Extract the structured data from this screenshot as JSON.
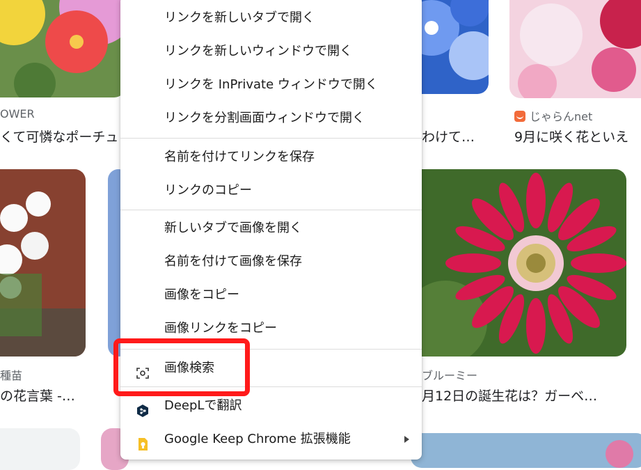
{
  "background_cards": {
    "card1_source": "OWER",
    "card1_title": "くて可憐なポーチュ",
    "card3_title": "わけて…",
    "card4_source": "じゃらんnet",
    "card4_title": "9月に咲く花といえ",
    "card5_source": "種苗",
    "card5_title": "の花言葉 -…",
    "card6_source": "ブルーミー",
    "card6_title": "月12日の誕生花は？ガーベ…"
  },
  "context_menu": {
    "items": [
      {
        "label": "リンクを新しいタブで開く"
      },
      {
        "label": "リンクを新しいウィンドウで開く"
      },
      {
        "label": "リンクを InPrivate ウィンドウで開く"
      },
      {
        "label": "リンクを分割画面ウィンドウで開く"
      },
      {
        "label": "名前を付けてリンクを保存"
      },
      {
        "label": "リンクのコピー"
      },
      {
        "label": "新しいタブで画像を開く"
      },
      {
        "label": "名前を付けて画像を保存"
      },
      {
        "label": "画像をコピー"
      },
      {
        "label": "画像リンクをコピー"
      },
      {
        "label": "画像検索",
        "icon": "visual-search-icon"
      },
      {
        "label": "DeepLで翻訳",
        "icon": "deepl-icon"
      },
      {
        "label": "Google Keep Chrome 拡張機能",
        "icon": "google-keep-icon",
        "has_submenu": true
      }
    ]
  },
  "colors": {
    "highlight_box": "#ff1a1a",
    "deepl": "#0f2b46",
    "google_keep": "#f6bf26"
  }
}
